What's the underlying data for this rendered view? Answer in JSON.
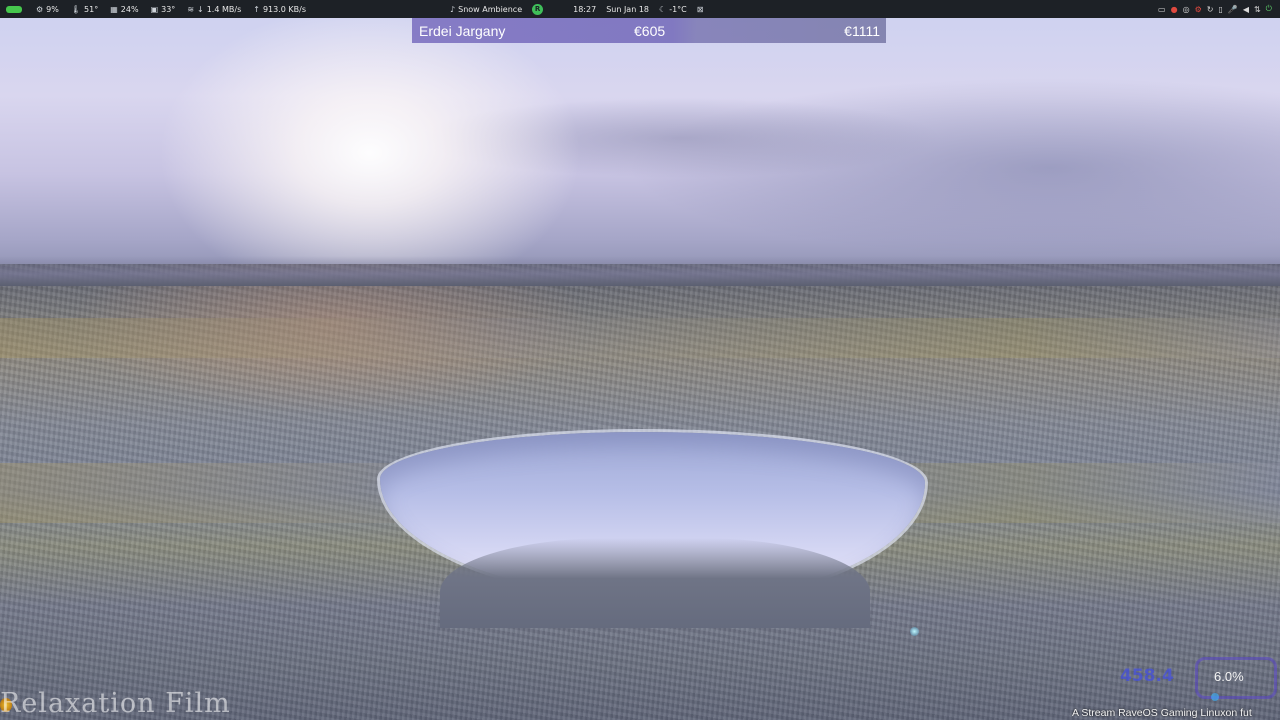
{
  "topbar": {
    "left": [
      {
        "icon": "battery-icon",
        "text": ""
      },
      {
        "icon": "cpu-icon",
        "glyph": "⚙",
        "text": "9%"
      },
      {
        "icon": "temperature-icon",
        "glyph": "🌡",
        "text": "51°"
      },
      {
        "icon": "memory-icon",
        "glyph": "▦",
        "text": "24%"
      },
      {
        "icon": "gpu-temp-icon",
        "glyph": "▣",
        "text": "33°"
      },
      {
        "icon": "wifi-icon",
        "glyph": "≋",
        "text": ""
      },
      {
        "icon": "download-icon",
        "glyph": "↓",
        "text": "1.4 MB/s"
      },
      {
        "icon": "upload-icon",
        "glyph": "↑",
        "text": "913.0 KB/s"
      }
    ],
    "music": {
      "icon": "music-note-icon",
      "glyph": "♪",
      "title": "Snow Ambience",
      "badge": "R"
    },
    "time": "18:27",
    "date": "Sun Jan 18",
    "weather": {
      "icon": "moon-icon",
      "glyph": "☾",
      "temp": "-1°C"
    },
    "weather_extra_icon": "⊠",
    "tray": [
      {
        "name": "screen-share-icon",
        "glyph": "▭",
        "cls": ""
      },
      {
        "name": "record-icon",
        "glyph": "●",
        "cls": "red"
      },
      {
        "name": "steam-icon",
        "glyph": "◎",
        "cls": ""
      },
      {
        "name": "settings-icon",
        "glyph": "⚙",
        "cls": "red"
      },
      {
        "name": "sync-icon",
        "glyph": "↻",
        "cls": ""
      },
      {
        "name": "clipboard-icon",
        "glyph": "▯",
        "cls": ""
      },
      {
        "name": "microphone-icon",
        "glyph": "🎤",
        "cls": ""
      },
      {
        "name": "volume-icon",
        "glyph": "◀",
        "cls": ""
      },
      {
        "name": "network-icon",
        "glyph": "⇅",
        "cls": ""
      },
      {
        "name": "power-icon",
        "glyph": "⏻",
        "cls": "green"
      }
    ]
  },
  "ticker": {
    "name": "Erdei Jargany",
    "value1": "€605",
    "value2": "€1111"
  },
  "overlays": {
    "logo": "Relaxation Film",
    "cpu_ghost": "458.4",
    "cpu_percent": "6.0%",
    "stream_caption": "A Stream RaveOS Gaming Linuxon fut"
  }
}
